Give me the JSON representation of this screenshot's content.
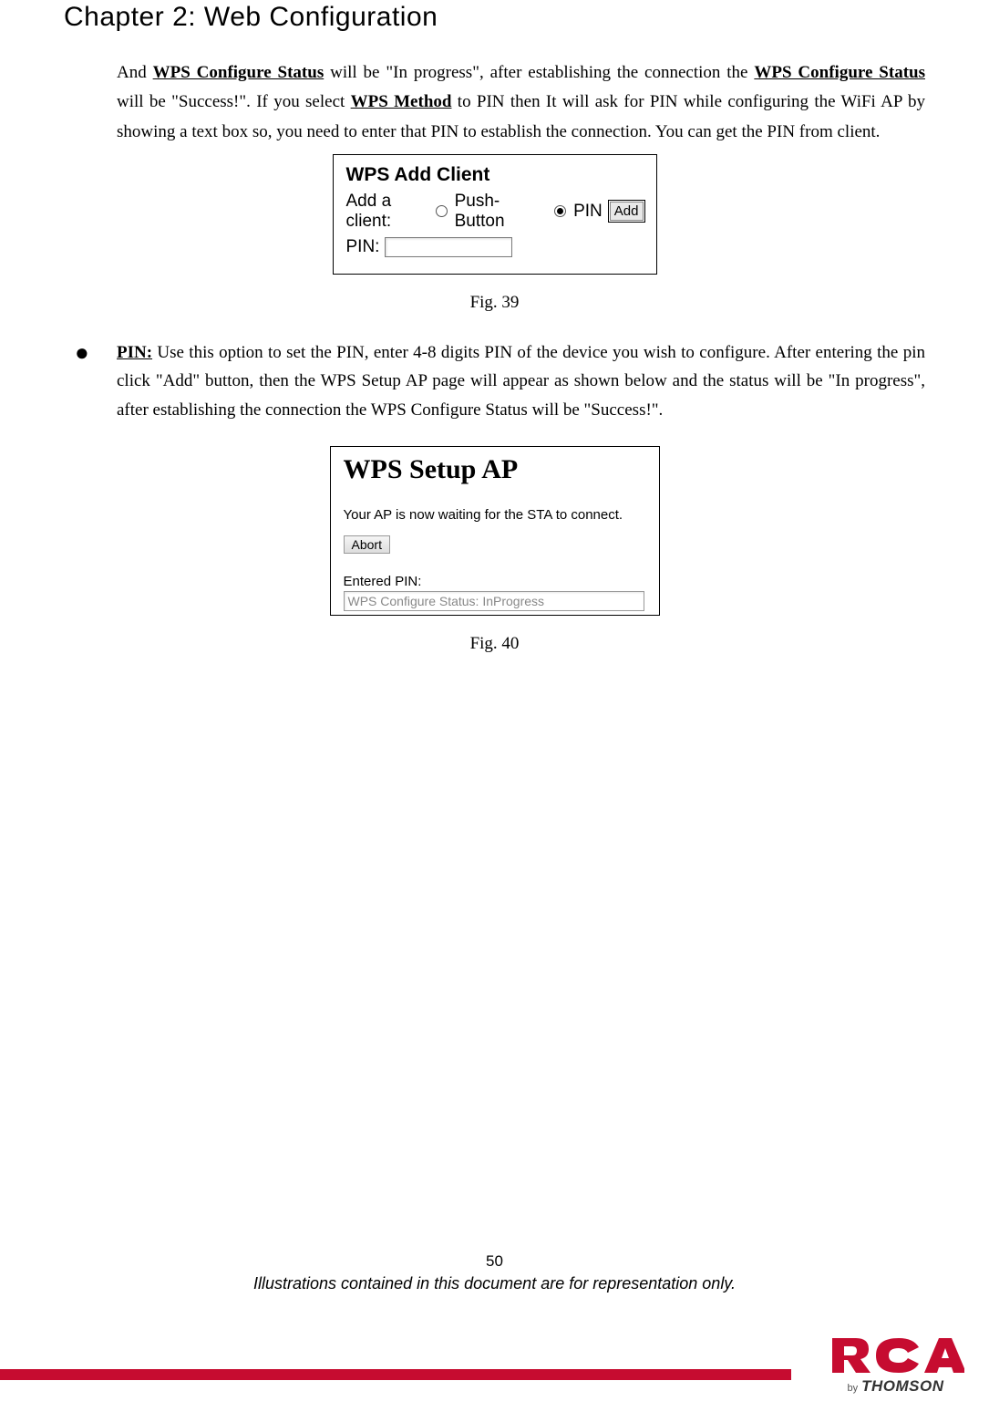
{
  "chapter_title": "Chapter 2: Web Configuration",
  "para1": {
    "pre": "And ",
    "b1": "WPS Configure Status",
    "mid1": " will be \"In progress\", after establishing the connection the ",
    "b2": "WPS Configure Status",
    "mid2": " will be \"Success!\". If you select ",
    "b3": "WPS Method",
    "post": " to PIN then It will ask for PIN while configuring the WiFi AP by showing a text box so, you need to enter that PIN to establish the connection. You can get the PIN from client."
  },
  "fig39": {
    "title": "WPS Add Client",
    "add_client_label": "Add a client:",
    "opt_push": "Push-Button",
    "opt_pin": "PIN",
    "add_btn": "Add",
    "pin_label": "PIN:",
    "caption": "Fig. 39"
  },
  "bullet": {
    "lead": "PIN:",
    "text": " Use this option to set the PIN, enter 4-8 digits PIN of the device you wish to configure. After entering the pin click \"Add\" button, then the WPS Setup AP page will appear as shown below and the status will be \"In progress\", after establishing the connection the WPS Configure Status will be \"Success!\"."
  },
  "fig40": {
    "title": "WPS Setup AP",
    "waiting": "Your AP is now waiting for the STA to connect.",
    "abort_btn": "Abort",
    "entered_pin": "Entered PIN:",
    "status_box": "WPS Configure Status: InProgress",
    "caption": "Fig. 40"
  },
  "footer": {
    "page_num": "50",
    "disclaimer": "Illustrations contained in this document are for representation only."
  },
  "logo": {
    "rca": "RCA",
    "by": "by",
    "thomson": "THOMSON"
  }
}
